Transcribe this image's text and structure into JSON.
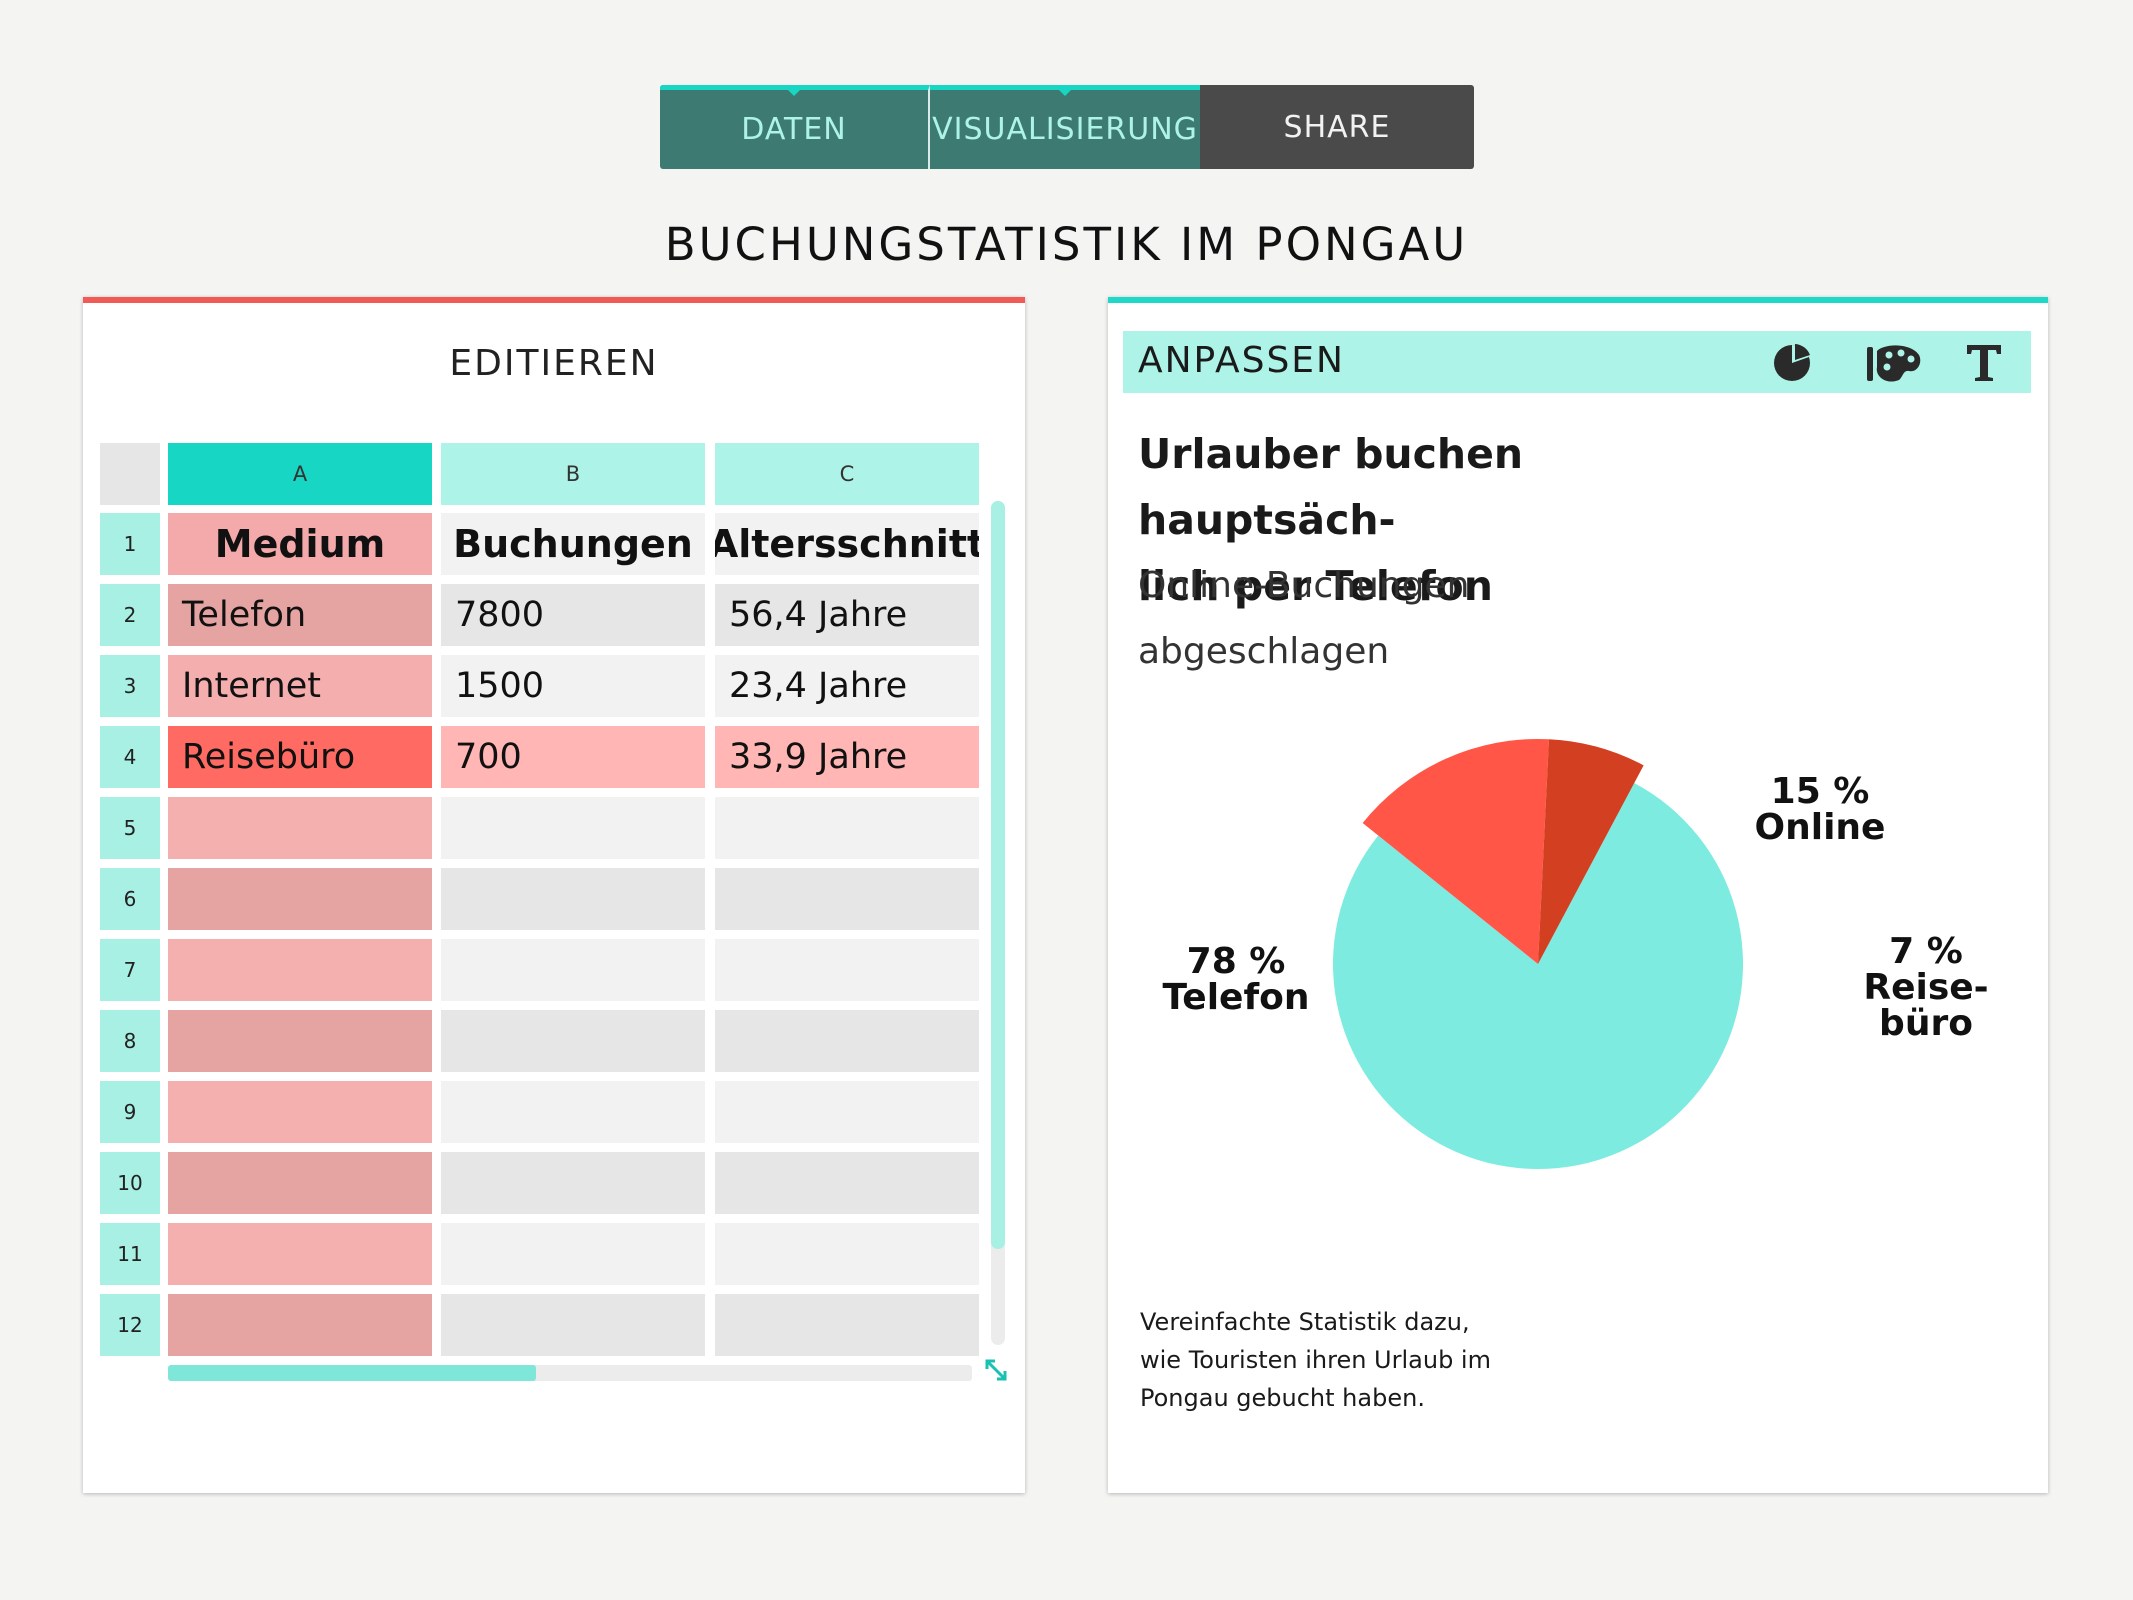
{
  "tabs": [
    {
      "label": "DATEN"
    },
    {
      "label": "VISUALISIERUNG"
    },
    {
      "label": "SHARE"
    }
  ],
  "page_title": "BUCHUNGSTATISTIK IM PONGAU",
  "editor": {
    "title": "EDITIEREN",
    "columns": [
      "A",
      "B",
      "C"
    ],
    "row_numbers": [
      "1",
      "2",
      "3",
      "4",
      "5",
      "6",
      "7",
      "8",
      "9",
      "10",
      "11",
      "12"
    ],
    "rows": [
      [
        "Medium",
        "Buchungen",
        "Altersschnitt"
      ],
      [
        "Telefon",
        "7800",
        "56,4 Jahre"
      ],
      [
        "Internet",
        "1500",
        "23,4 Jahre"
      ],
      [
        "Reisebüro",
        "700",
        "33,9 Jahre"
      ],
      [
        "",
        "",
        ""
      ],
      [
        "",
        "",
        ""
      ],
      [
        "",
        "",
        ""
      ],
      [
        "",
        "",
        ""
      ],
      [
        "",
        "",
        ""
      ],
      [
        "",
        "",
        ""
      ],
      [
        "",
        "",
        ""
      ],
      [
        "",
        "",
        ""
      ]
    ],
    "vertical_scroll_fraction": 0.89,
    "horizontal_scroll_fraction": 0.46
  },
  "adjust": {
    "title": "ANPASSEN",
    "icons": [
      "pie-chart-icon",
      "palette-icon",
      "text-icon"
    ]
  },
  "chart_data": {
    "type": "pie",
    "title": "Urlauber buchen hauptsächlich per Telefon",
    "title_lines": [
      "Urlauber buchen hauptsäch-",
      "lich per Telefon"
    ],
    "subtitle_lines": [
      "Online-Buchungen",
      "abgeschlagen"
    ],
    "slices": [
      {
        "name": "Telefon",
        "value": 78,
        "label_lines": [
          "78 %",
          "Telefon"
        ],
        "color": "#7eebe0",
        "exploded": false
      },
      {
        "name": "Online",
        "value": 15,
        "label_lines": [
          "15 %",
          "Online"
        ],
        "color": "#ff5648",
        "exploded": true
      },
      {
        "name": "Reisebüro",
        "value": 7,
        "label_lines": [
          "7 %",
          "Reise-",
          "büro"
        ],
        "color": "#d24021",
        "exploded": true
      }
    ],
    "legend": "none"
  },
  "footnote_lines": [
    "Vereinfachte Statistik dazu,",
    "wie Touristen ihren Urlaub im",
    "Pongau gebucht haben."
  ],
  "colors": {
    "teal_dark": "#3d7a72",
    "teal_accent": "#17d6c4",
    "teal_light": "#aef3e7",
    "red_accent": "#f25a55",
    "share_tab": "#4a4a4a"
  }
}
